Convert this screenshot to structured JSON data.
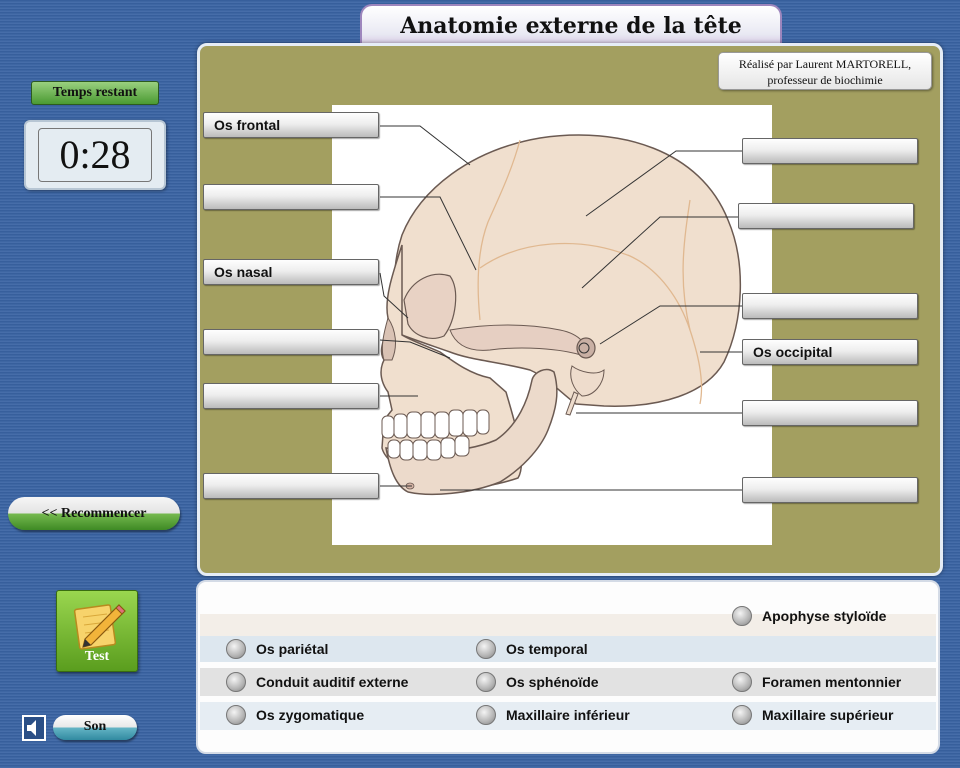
{
  "title": "Anatomie externe de la tête",
  "credit": {
    "line1": "Réalisé par Laurent MARTORELL,",
    "line2": "professeur de biochimie"
  },
  "timer": {
    "label": "Temps restant",
    "value": "0:28"
  },
  "buttons": {
    "restart": "<< Recommencer",
    "test": "Test",
    "sound": "Son"
  },
  "icons": {
    "test": "pencil-notepad-icon",
    "sound": "speaker-icon"
  },
  "labels": {
    "left": [
      "Os frontal",
      "",
      "Os nasal",
      "",
      "",
      ""
    ],
    "right": [
      "",
      "",
      "",
      "Os occipital",
      "",
      ""
    ]
  },
  "word_bank": {
    "row0": [
      "",
      "",
      "Apophyse styloïde"
    ],
    "row1": [
      "Os pariétal",
      "Os temporal",
      ""
    ],
    "row2": [
      "Conduit auditif externe",
      "Os sphénoïde",
      "Foramen mentonnier"
    ],
    "row3": [
      "Os zygomatique",
      "Maxillaire inférieur",
      "Maxillaire supérieur"
    ]
  },
  "colors": {
    "background": "#3a64a4",
    "panel": "#a39f60",
    "bone": "#f0dfce",
    "bone_shade": "#e6cfc2",
    "bone_outline": "#6b5a52",
    "timer_label": "#4a9a32",
    "test_button": "#7ab83a"
  }
}
